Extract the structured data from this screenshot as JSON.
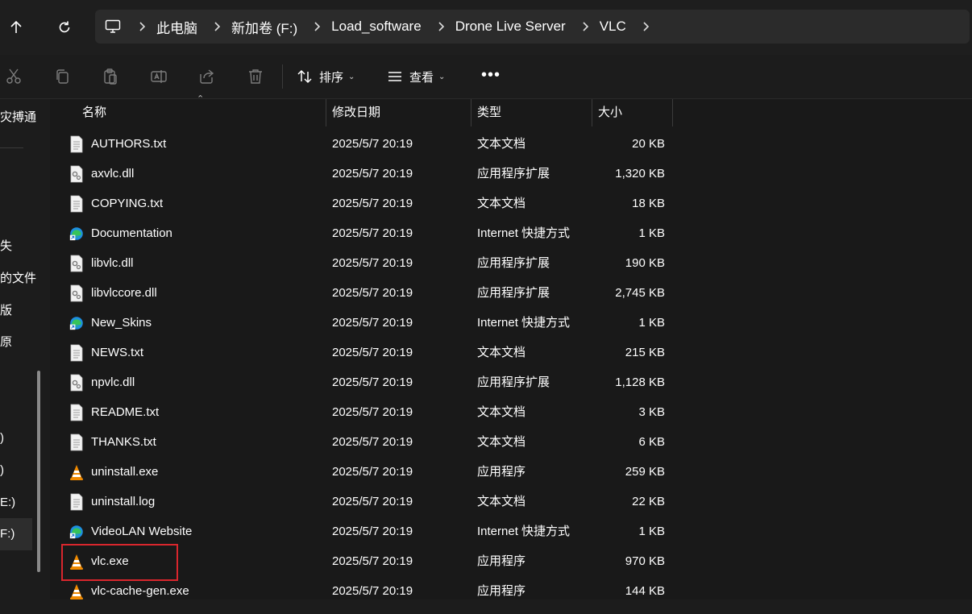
{
  "address_bar": {
    "breadcrumbs": [
      "此电脑",
      "新加卷 (F:)",
      "Load_software",
      "Drone Live Server",
      "VLC"
    ]
  },
  "toolbar": {
    "sort_label": "排序",
    "view_label": "查看",
    "more_label": "•••"
  },
  "nav_pane": {
    "fragments": [
      "灾搏通",
      "失",
      "的文件",
      "版",
      "原",
      ")",
      ")",
      "E:)",
      "F:)"
    ]
  },
  "columns": {
    "name": "名称",
    "date": "修改日期",
    "type": "类型",
    "size": "大小"
  },
  "files": [
    {
      "name": "AUTHORS.txt",
      "date": "2025/5/7 20:19",
      "type": "文本文档",
      "size": "20 KB",
      "icon": "text-file-icon"
    },
    {
      "name": "axvlc.dll",
      "date": "2025/5/7 20:19",
      "type": "应用程序扩展",
      "size": "1,320 KB",
      "icon": "dll-file-icon"
    },
    {
      "name": "COPYING.txt",
      "date": "2025/5/7 20:19",
      "type": "文本文档",
      "size": "18 KB",
      "icon": "text-file-icon"
    },
    {
      "name": "Documentation",
      "date": "2025/5/7 20:19",
      "type": "Internet 快捷方式",
      "size": "1 KB",
      "icon": "edge-shortcut-icon"
    },
    {
      "name": "libvlc.dll",
      "date": "2025/5/7 20:19",
      "type": "应用程序扩展",
      "size": "190 KB",
      "icon": "dll-file-icon"
    },
    {
      "name": "libvlccore.dll",
      "date": "2025/5/7 20:19",
      "type": "应用程序扩展",
      "size": "2,745 KB",
      "icon": "dll-file-icon"
    },
    {
      "name": "New_Skins",
      "date": "2025/5/7 20:19",
      "type": "Internet 快捷方式",
      "size": "1 KB",
      "icon": "edge-shortcut-icon"
    },
    {
      "name": "NEWS.txt",
      "date": "2025/5/7 20:19",
      "type": "文本文档",
      "size": "215 KB",
      "icon": "text-file-icon"
    },
    {
      "name": "npvlc.dll",
      "date": "2025/5/7 20:19",
      "type": "应用程序扩展",
      "size": "1,128 KB",
      "icon": "dll-file-icon"
    },
    {
      "name": "README.txt",
      "date": "2025/5/7 20:19",
      "type": "文本文档",
      "size": "3 KB",
      "icon": "text-file-icon"
    },
    {
      "name": "THANKS.txt",
      "date": "2025/5/7 20:19",
      "type": "文本文档",
      "size": "6 KB",
      "icon": "text-file-icon"
    },
    {
      "name": "uninstall.exe",
      "date": "2025/5/7 20:19",
      "type": "应用程序",
      "size": "259 KB",
      "icon": "vlc-cone-icon"
    },
    {
      "name": "uninstall.log",
      "date": "2025/5/7 20:19",
      "type": "文本文档",
      "size": "22 KB",
      "icon": "text-file-icon"
    },
    {
      "name": "VideoLAN Website",
      "date": "2025/5/7 20:19",
      "type": "Internet 快捷方式",
      "size": "1 KB",
      "icon": "edge-shortcut-icon"
    },
    {
      "name": "vlc.exe",
      "date": "2025/5/7 20:19",
      "type": "应用程序",
      "size": "970 KB",
      "icon": "vlc-cone-icon"
    },
    {
      "name": "vlc-cache-gen.exe",
      "date": "2025/5/7 20:19",
      "type": "应用程序",
      "size": "144 KB",
      "icon": "vlc-cone-icon"
    }
  ],
  "highlight_color": "#d9262d",
  "accent_colors": {
    "vlc_orange": "#f08a00",
    "edge_blue": "#1d8fe0",
    "edge_green": "#37c35a"
  }
}
